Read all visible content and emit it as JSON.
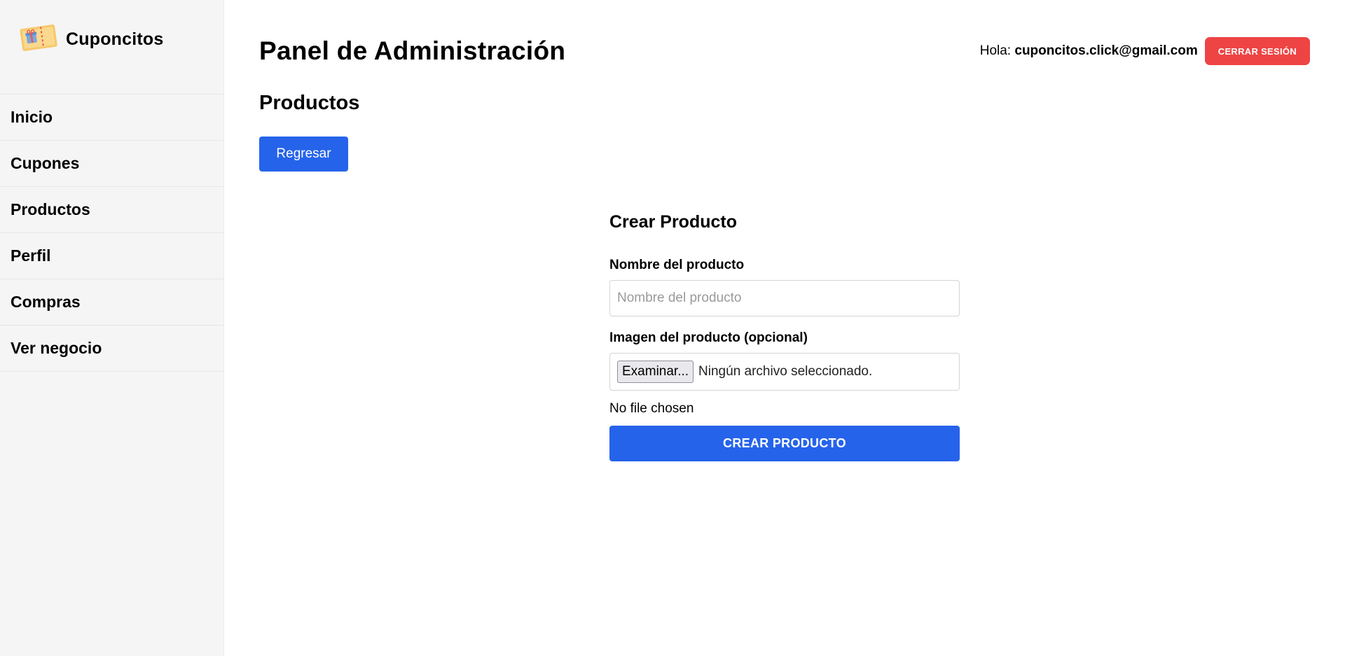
{
  "brand": {
    "name": "Cuponcitos",
    "logo_icon": "coupon-ticket-icon"
  },
  "sidebar": {
    "items": [
      {
        "label": "Inicio"
      },
      {
        "label": "Cupones"
      },
      {
        "label": "Productos"
      },
      {
        "label": "Perfil"
      },
      {
        "label": "Compras"
      },
      {
        "label": "Ver negocio"
      }
    ]
  },
  "header": {
    "title": "Panel de Administración",
    "greeting_prefix": "Hola:",
    "user_email": "cuponcitos.click@gmail.com",
    "logout_label": "CERRAR SESIÓN"
  },
  "section": {
    "title": "Productos",
    "back_label": "Regresar"
  },
  "form": {
    "title": "Crear Producto",
    "name_label": "Nombre del producto",
    "name_placeholder": "Nombre del producto",
    "name_value": "",
    "image_label": "Imagen del producto (opcional)",
    "file_button_label": "Examinar...",
    "file_status": "Ningún archivo seleccionado.",
    "no_file_text": "No file chosen",
    "submit_label": "CREAR PRODUCTO"
  },
  "colors": {
    "primary": "#2563eb",
    "danger": "#ee4444",
    "sidebar_bg": "#f5f5f6",
    "logo_ticket": "#f9d27a",
    "logo_gift": "#7aa7e0"
  }
}
